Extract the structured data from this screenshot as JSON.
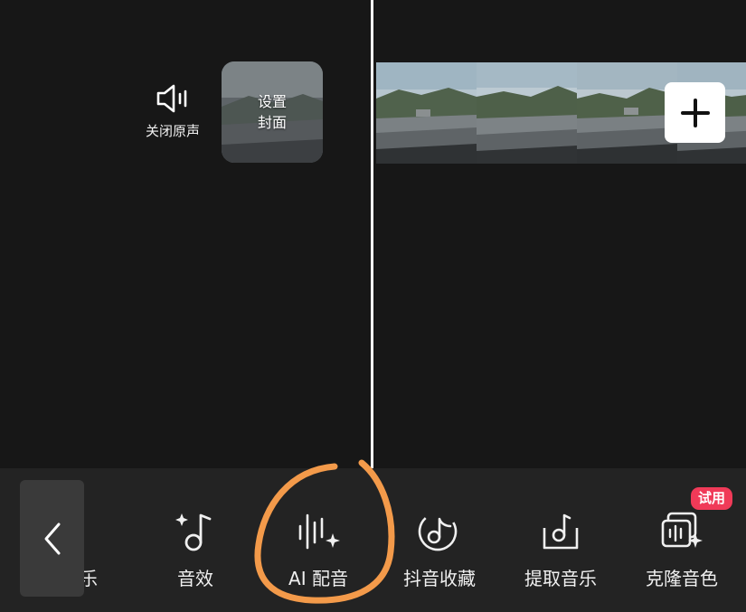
{
  "editor": {
    "mute_label": "关闭原声",
    "cover_line1": "设置",
    "cover_line2": "封面"
  },
  "toolbar": {
    "partial_label": "乐",
    "items": [
      {
        "label": "音效",
        "icon": "music-note-sparkle-icon"
      },
      {
        "label": "AI 配音",
        "icon": "voice-waveform-sparkle-icon"
      },
      {
        "label": "抖音收藏",
        "icon": "douyin-music-icon"
      },
      {
        "label": "提取音乐",
        "icon": "extract-music-icon"
      },
      {
        "label": "克隆音色",
        "icon": "clone-voice-icon"
      }
    ],
    "badge": "试用"
  },
  "colors": {
    "background": "#171717",
    "toolbar": "#232323",
    "annotation": "#f39a4a",
    "badge": "#f03a58"
  }
}
